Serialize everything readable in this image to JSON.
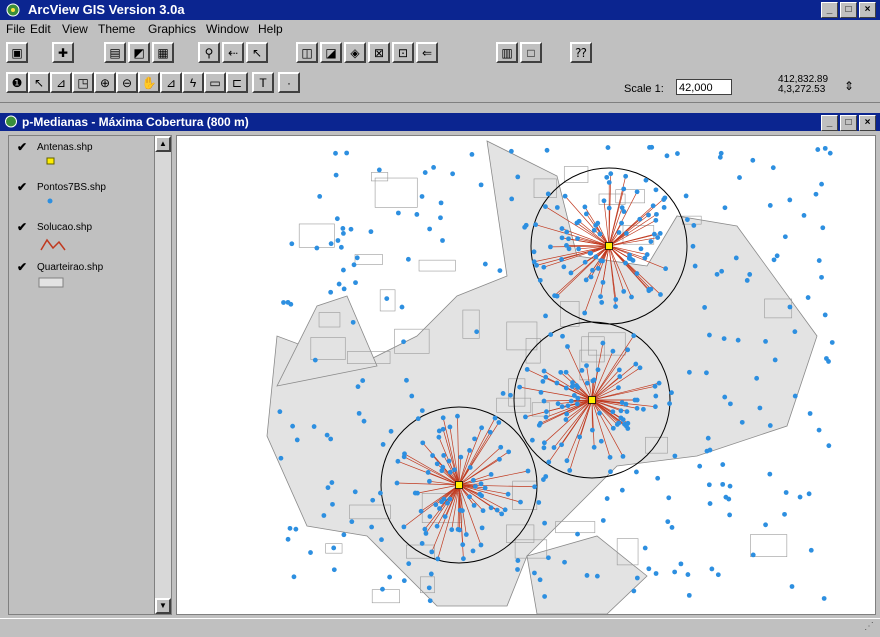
{
  "app": {
    "title": "ArcView GIS Version 3.0a",
    "window_buttons": [
      "_",
      "□",
      "×"
    ]
  },
  "menu": [
    "File",
    "Edit",
    "View",
    "Theme",
    "Graphics",
    "Window",
    "Help"
  ],
  "toolbar1": {
    "buttons": [
      "save-icon",
      "add-theme-icon",
      "theme-properties-icon",
      "edit-legend-icon",
      "table-icon",
      "find-icon",
      "query-icon",
      "select-arrow-icon",
      "zoom-full-icon",
      "zoom-active-icon",
      "zoom-selected-icon",
      "zoom-in-icon",
      "zoom-out-icon",
      "zoom-previous-icon",
      "layout-icon",
      "blank-icon",
      "help-icon"
    ]
  },
  "toolbar2": {
    "buttons": [
      "identify-icon",
      "pointer-icon",
      "vertex-icon",
      "select-feature-icon",
      "zoom-in-tool-icon",
      "zoom-out-tool-icon",
      "pan-icon",
      "measure-icon",
      "hotlink-icon",
      "area-icon",
      "label-icon",
      "text-icon",
      "draw-icon"
    ],
    "scale_label": "Scale 1:",
    "scale_value": "42,000",
    "coord_x": "412,832.89",
    "coord_y": "4,3,272.53"
  },
  "view": {
    "title": "p-Medianas - Máxima Cobertura (800 m)"
  },
  "themes": [
    {
      "name": "Antenas.shp",
      "legend": "yellow-square-icon"
    },
    {
      "name": "Pontos7BS.shp",
      "legend": "blue-dot-icon"
    },
    {
      "name": "Solucao.shp",
      "legend": "red-line-icon"
    },
    {
      "name": "Quarteirao.shp",
      "legend": "grey-polygon-icon"
    }
  ],
  "colors": {
    "titlebar": "#0b2590",
    "points": "#2d8fe0",
    "lines": "#c0391f",
    "antenna": "#ffee00",
    "blocks": "#e3e3e3"
  }
}
